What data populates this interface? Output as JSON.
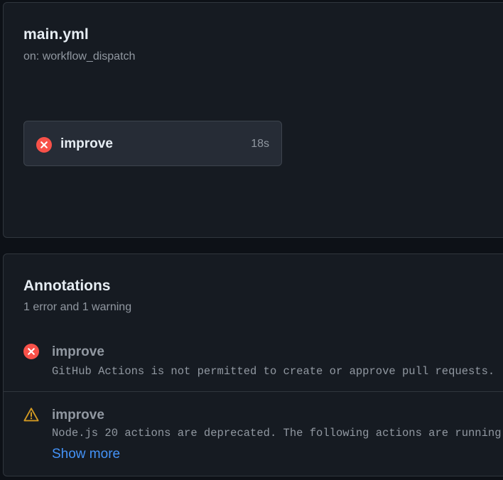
{
  "workflow": {
    "file_name": "main.yml",
    "trigger": "on: workflow_dispatch",
    "job": {
      "name": "improve",
      "duration": "18s",
      "status": "failure",
      "status_icon": "x-circle-fill-icon"
    }
  },
  "annotations": {
    "title": "Annotations",
    "summary": "1 error and 1 warning",
    "items": [
      {
        "type": "error",
        "icon": "x-circle-fill-icon",
        "job": "improve",
        "message": "GitHub Actions is not permitted to create or approve pull requests."
      },
      {
        "type": "warning",
        "icon": "alert-triangle-icon",
        "job": "improve",
        "message": "Node.js 20 actions are deprecated. The following actions are running",
        "show_more_label": "Show more"
      }
    ]
  },
  "colors": {
    "background": "#0d1117",
    "panel": "#161b22",
    "border": "#30363d",
    "error": "#f85149",
    "warning": "#d29922",
    "link": "#4493f8",
    "muted_text": "#9198a1",
    "primary_text": "#e6edf3"
  }
}
